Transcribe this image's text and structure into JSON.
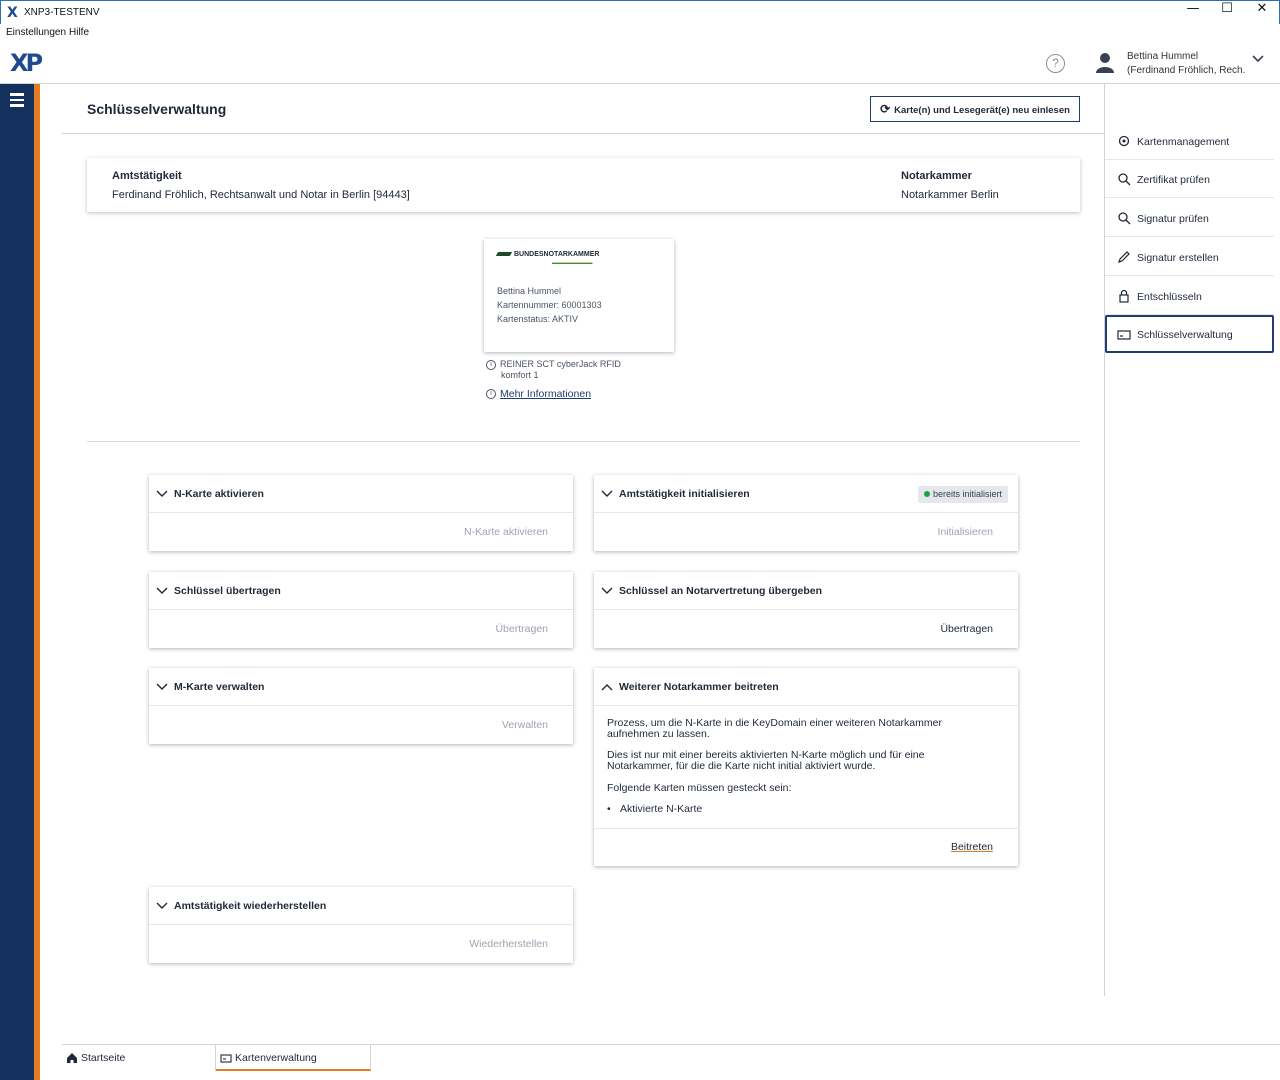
{
  "window": {
    "title": "XNP3-TESTENV",
    "app_icon": "X"
  },
  "menu": {
    "items": [
      "Einstellungen",
      "Hilfe"
    ]
  },
  "header": {
    "logo": "XP",
    "user_name": "Bettina Hummel",
    "user_org": "(Ferdinand Fröhlich, Rech..."
  },
  "main": {
    "title": "Schlüsselverwaltung",
    "reload_button": "Karte(n) und Lesegerät(e) neu einlesen",
    "office_label": "Amtstätigkeit",
    "office_value": "Ferdinand Fröhlich, Rechtsanwalt und Notar in Berlin [94443]",
    "chamber_label": "Notarkammer",
    "chamber_value": "Notarkammer Berlin",
    "card": {
      "brand": "BUNDESNOTARKAMMER",
      "holder": "Bettina Hummel",
      "number": "Kartennummer: 60001303",
      "status": "Kartenstatus: AKTIV"
    },
    "reader_line1": "REINER SCT cyberJack RFID",
    "reader_line2": "komfort 1",
    "more_info": "Mehr Informationen"
  },
  "panels": {
    "activate": {
      "title": "N-Karte aktivieren",
      "action": "N-Karte aktivieren"
    },
    "init": {
      "title": "Amtstätigkeit initialisieren",
      "badge": "bereits initialisiert",
      "action": "Initialisieren"
    },
    "transfer": {
      "title": "Schlüssel übertragen",
      "action": "Übertragen"
    },
    "handover": {
      "title": "Schlüssel an Notarvertretung übergeben",
      "action": "Übertragen"
    },
    "mcard": {
      "title": "M-Karte verwalten",
      "action": "Verwalten"
    },
    "join": {
      "title": "Weiterer Notarkammer beitreten",
      "p1_l1": "Prozess, um die N-Karte in die KeyDomain einer weiteren Notarkammer",
      "p1_l2": "aufnehmen zu lassen.",
      "p2_l1": "Dies ist nur mit einer bereits aktivierten N-Karte möglich und für eine",
      "p2_l2": "Notarkammer, für die die Karte nicht initial aktiviert wurde.",
      "p3": "Folgende Karten müssen gesteckt sein:",
      "bullet": "Aktivierte N-Karte",
      "action": "Beitreten"
    },
    "restore": {
      "title": "Amtstätigkeit wiederherstellen",
      "action": "Wiederherstellen"
    }
  },
  "rightnav": {
    "items": [
      "Kartenmanagement",
      "Zertifikat prüfen",
      "Signatur prüfen",
      "Signatur erstellen",
      "Entschlüsseln",
      "Schlüsselverwaltung"
    ]
  },
  "tabs": [
    "Startseite",
    "Kartenverwaltung"
  ],
  "colors": {
    "navy": "#14315d",
    "accent": "#e27d22",
    "success": "#16a34a"
  }
}
